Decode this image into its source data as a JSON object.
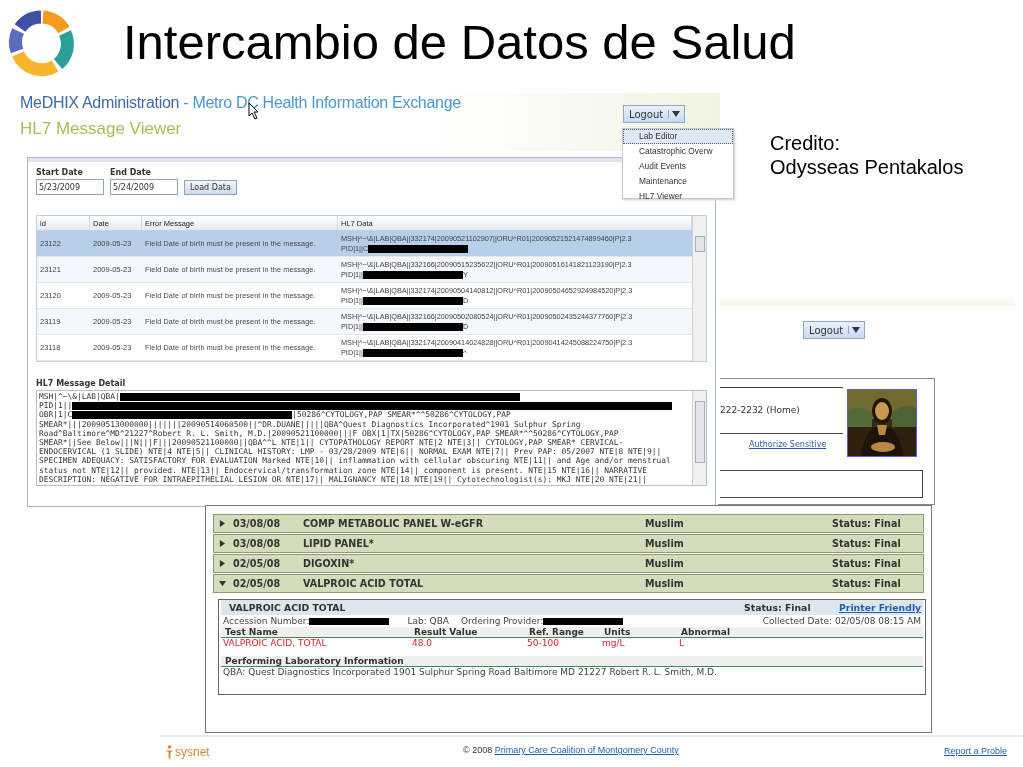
{
  "slide": {
    "title": "Intercambio de Datos de Salud",
    "credit": [
      "Credito:",
      "Odysseas Pentakalos"
    ]
  },
  "hl7_viewer": {
    "app_title": "MeDHIX Administration",
    "app_subtitle": "- Metro DC Health Information Exchange",
    "page_title": "HL7 Message Viewer",
    "logout": "Logout",
    "menu": [
      {
        "label": "Lab Editor",
        "selected": true
      },
      {
        "label": "Catastrophic Overw",
        "selected": false
      },
      {
        "label": "Audit Events",
        "selected": false
      },
      {
        "label": "Maintenance",
        "selected": false
      },
      {
        "label": "HL7 Viewer",
        "selected": false
      }
    ],
    "start_date_label": "Start Date",
    "start_date": "5/23/2009",
    "end_date_label": "End Date",
    "end_date": "5/24/2009",
    "load_button": "Load Data",
    "columns": [
      "id",
      "Date",
      "Error Message",
      "HL7 Data"
    ],
    "rows": [
      {
        "id": "23122",
        "date": "2009-05-23",
        "error": "Field Date of birth must be present in the message.",
        "data": "MSH|^~\\&|LAB|QBA||332174|20090521102907||ORU^R01|20090521521474899460|P|2.3",
        "pid": "PID|1||C",
        "selected": true
      },
      {
        "id": "23121",
        "date": "2009-05-23",
        "error": "Field Date of birth must be present in the message.",
        "data": "MSH|^~\\&|LAB|QBA||332166|20090515235622||ORU^R01|20090516141821123190|P|2.3",
        "pid": "PID|1||",
        "pid_tail": "Y",
        "selected": false
      },
      {
        "id": "23120",
        "date": "2009-05-23",
        "error": "Field Date of birth must be present in the message.",
        "data": "MSH|^~\\&|LAB|QBA||332174|20090504140812||ORU^R01|20090504652924984520|P|2.3",
        "pid": "PID|1||",
        "pid_tail": "D",
        "selected": false
      },
      {
        "id": "23119",
        "date": "2009-05-23",
        "error": "Field Date of birth must be present in the message.",
        "data": "MSH|^~\\&|LAB|QBA||332166|20090502080524||ORU^R01|20090502435244377760|P|2.3",
        "pid": "PID|1||",
        "pid_tail": "D",
        "selected": false
      },
      {
        "id": "23118",
        "date": "2009-05-23",
        "error": "Field Date of birth must be present in the message.",
        "data": "MSH|^~\\&|LAB|QBA||332174|20090414024828||ORU^R01|20090414245088224750|P|2.3",
        "pid": "PID|1||",
        "pid_tail": "^",
        "selected": false
      }
    ],
    "detail_title": "HL7 Message Detail",
    "detail_lines": [
      {
        "text": "MSH|^~\\&|LAB|QBA|",
        "redacted": true
      },
      {
        "text": "PID|1||",
        "redacted": true
      },
      {
        "text": "OBR|1|C",
        "redacted": true,
        "tail": "|50286^CYTOLOGY,PAP SMEAR*^^50286^CYTOLOGY,PAP"
      },
      {
        "text": "SMEAR*|||20090513000000|||||||20090514060500||^DR.DUANE|||||QBA^Quest Diagnostics Incorporated^1901 Sulphur Spring"
      },
      {
        "text": "Road^Baltimore^MD^21227^Robert R. L. Smith, M.D.|20090521100000|||F OBX|1|TX|50286^CYTOLOGY,PAP SMEAR*^^50286^CYTOLOGY,PAP"
      },
      {
        "text": "SMEAR*||See Below|||N|||F|||20090521100000||QBA^^L NTE|1|| CYTOPATHOLOGY REPORT NTE|2 NTE|3|| CYTOLOGY,PAP SMEAR* CERVICAL-"
      },
      {
        "text": "ENDOCERVICAL (1 SLIDE) NTE|4 NTE|5|| CLINICAL HISTORY: LMP - 03/28/2009 NTE|6|| NORMAL EXAM NTE|7|| Prev PAP: 05/2007 NTE|8 NTE|9||"
      },
      {
        "text": "SPECIMEN ADEQUACY: SATISFACTORY FOR EVALUATION Marked NTE|10|| inflammation with cellular obscuring NTE|11|| and Age and/or menstrual"
      },
      {
        "text": "status not NTE|12|| provided. NTE|13|| Endocervical/transformation zone NTE|14|| component is present. NTE|15 NTE|16|| NARRATIVE"
      },
      {
        "text": "DESCRIPTION: NEGATIVE FOR INTRAEPITHELIAL LESION OR NTE|17|| MALIGNANCY NTE|18 NTE|19|| Cytotechnologist(s): MKJ NTE|20 NTE|21||"
      }
    ]
  },
  "patient_view": {
    "logout": "Logout",
    "phone": "222-2232 (Home)",
    "authorize_link": "Authorize Sensitive"
  },
  "lab_results": {
    "rows": [
      {
        "date": "03/08/08",
        "test": "COMP METABOLIC PANEL W-eGFR",
        "column_3": "Muslim",
        "status": "Status: Final",
        "expanded": false
      },
      {
        "date": "03/08/08",
        "test": "LIPID PANEL*",
        "column_3": "Muslim",
        "status": "Status: Final",
        "expanded": false
      },
      {
        "date": "02/05/08",
        "test": "DIGOXIN*",
        "column_3": "Muslim",
        "status": "Status: Final",
        "expanded": false
      },
      {
        "date": "02/05/08",
        "test": "VALPROIC ACID TOTAL",
        "column_3": "Muslim",
        "status": "Status: Final",
        "expanded": true
      }
    ],
    "detail": {
      "title": "VALPROIC ACID TOTAL",
      "status": "Status: Final",
      "printer_link": "Printer Friendly",
      "accession_label": "Accession Number:",
      "lab": "Lab: QBA",
      "provider_label": "Ordering Provider:",
      "collected": "Collected Date: 02/05/08 08:15 AM",
      "columns": [
        "Test Name",
        "Result Value",
        "Ref. Range",
        "Units",
        "Abnormal"
      ],
      "results": [
        {
          "cells": [
            "VALPROIC ACID, TOTAL",
            "48.0",
            "50-100",
            "mg/L",
            "L"
          ],
          "abnormal": true
        }
      ],
      "lab_info_title": "Performing Laboratory Information",
      "lab_info": "QBA: Quest Diagnostics Incorporated 1901 Sulphur Spring Road Baltimore MD 21227 Robert R. L. Smith, M.D."
    }
  },
  "footer": {
    "logo": "sysnet",
    "copyright": "© 2008",
    "org_link": "Primary Care Coalition of Montgomery County",
    "report_link": "Report a Proble"
  }
}
